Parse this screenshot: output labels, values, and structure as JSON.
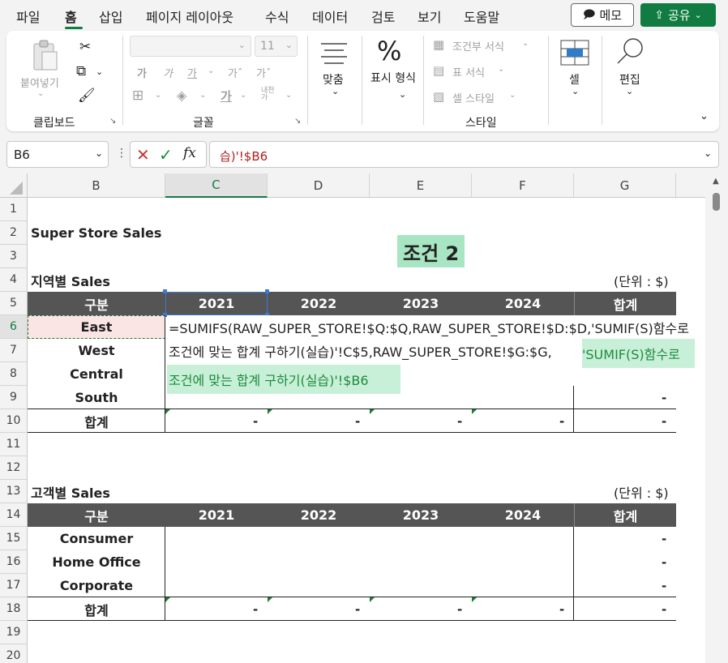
{
  "menu": {
    "items": [
      "파일",
      "홈",
      "삽입",
      "페이지 레이아웃",
      "수식",
      "데이터",
      "검토",
      "보기",
      "도움말"
    ],
    "active": "홈",
    "memo_label": "메모",
    "share_label": "공유"
  },
  "ribbon": {
    "clipboard": {
      "paste_label": "붙여넣기",
      "group_label": "클립보드"
    },
    "font": {
      "font_size": "11",
      "bold": "가",
      "italic": "가",
      "underline": "가",
      "grow": "가ˆ",
      "shrink": "가ˇ",
      "group_label": "글꼴"
    },
    "alignment": {
      "label": "맞춤"
    },
    "number": {
      "label": "표시 형식",
      "symbol": "%"
    },
    "styles": {
      "conditional": "조건부 서식",
      "table": "표 서식",
      "cell_style": "셀 스타일",
      "group_label": "스타일"
    },
    "cells": {
      "label": "셀"
    },
    "editing": {
      "label": "편집"
    }
  },
  "formula_bar": {
    "name_box": "B6",
    "formula": "습)'!$B6",
    "fx": "fx"
  },
  "sheet": {
    "columns": [
      "B",
      "C",
      "D",
      "E",
      "F",
      "G"
    ],
    "rows": [
      "1",
      "2",
      "3",
      "4",
      "5",
      "6",
      "7",
      "8",
      "9",
      "10",
      "11",
      "12",
      "13",
      "14",
      "15",
      "16",
      "17",
      "18",
      "19",
      "20"
    ],
    "title": "Super Store Sales",
    "condition_badge": "조건 2",
    "region_section": "지역별 Sales",
    "unit": "(단위 : $)",
    "table_headers": [
      "구분",
      "2021",
      "2022",
      "2023",
      "2024",
      "합계"
    ],
    "regions": [
      "East",
      "West",
      "Central",
      "South"
    ],
    "total_label": "합계",
    "customer_section": "고객별 Sales",
    "segments": [
      "Consumer",
      "Home Office",
      "Corporate"
    ],
    "dash": "-",
    "formula_line1": "=SUMIFS(RAW_SUPER_STORE!$Q:$Q,RAW_SUPER_STORE!$D:$D,'SUMIF(S)함수로",
    "formula_line2a": "조건에 맞는 합계 구하기(실습)'!C$5,RAW_SUPER_STORE!$G:$G,",
    "formula_line2b": "'SUMIF(S)함수로",
    "formula_line3": "조건에 맞는 합계 구하기(실습)'!$B6"
  },
  "colors": {
    "accent": "#107c41",
    "header_dark": "#555555",
    "badge_green": "#a8e6c3",
    "selected_pink": "#fbe4e4"
  }
}
